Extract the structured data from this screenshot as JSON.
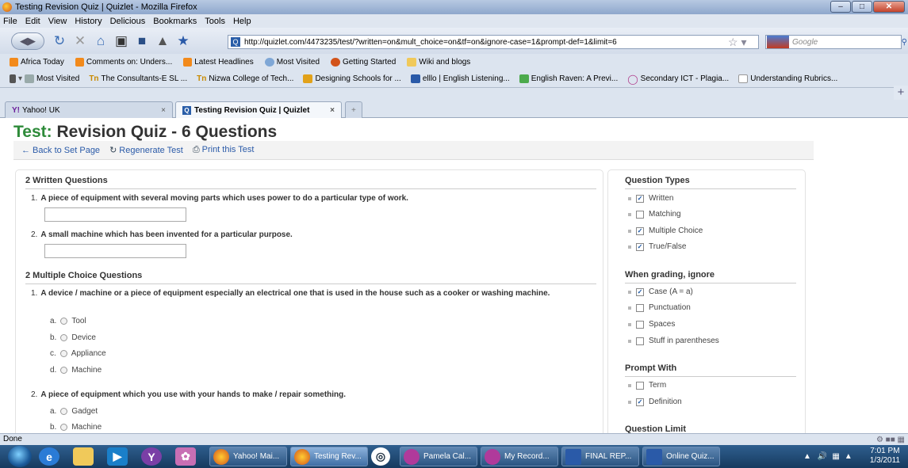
{
  "window": {
    "title": "Testing Revision Quiz | Quizlet - Mozilla Firefox"
  },
  "menu": [
    "File",
    "Edit",
    "View",
    "History",
    "Delicious",
    "Bookmarks",
    "Tools",
    "Help"
  ],
  "url": "http://quizlet.com/4473235/test/?written=on&mult_choice=on&tf=on&ignore-case=1&prompt-def=1&limit=6",
  "search_placeholder": "Google",
  "bookmarks_row1": [
    "Africa Today",
    "Comments on: Unders...",
    "Latest Headlines",
    "Most Visited",
    "Getting Started",
    "Wiki and blogs"
  ],
  "bookmarks_row2": [
    "Most Visited",
    "The Consultants-E SL ...",
    "Nizwa College of Tech...",
    "Designing Schools for ...",
    "elllo | English Listening...",
    "English Raven: A Previ...",
    "Secondary ICT - Plagia...",
    "Understanding Rubrics..."
  ],
  "tabs": [
    {
      "label": "Yahoo! UK"
    },
    {
      "label": "Testing Revision Quiz | Quizlet"
    }
  ],
  "page": {
    "title_label": "Test:",
    "title_text": "Revision Quiz - 6 Questions",
    "actions": [
      "← Back to Set Page",
      "Regenerate Test",
      "Print this Test"
    ]
  },
  "written": {
    "heading": "2 Written Questions",
    "questions": [
      {
        "num": "1.",
        "text": "A piece of equipment with several moving parts which uses power to do a particular type of work."
      },
      {
        "num": "2.",
        "text": "A small machine which has been invented for a particular purpose."
      }
    ]
  },
  "mc": {
    "heading": "2 Multiple Choice Questions",
    "questions": [
      {
        "num": "1.",
        "text": "A device / machine or a piece of equipment especially an electrical one that is used in the house such as a cooker or washing machine.",
        "options": [
          {
            "letter": "a.",
            "text": "Tool"
          },
          {
            "letter": "b.",
            "text": "Device"
          },
          {
            "letter": "c.",
            "text": "Appliance"
          },
          {
            "letter": "d.",
            "text": "Machine"
          }
        ]
      },
      {
        "num": "2.",
        "text": "A piece of equipment which you use with your hands to make / repair something.",
        "options": [
          {
            "letter": "a.",
            "text": "Gadget"
          },
          {
            "letter": "b.",
            "text": "Machine"
          }
        ]
      }
    ]
  },
  "sidebar": {
    "question_types": {
      "heading": "Question Types",
      "items": [
        {
          "label": "Written",
          "checked": true
        },
        {
          "label": "Matching",
          "checked": false
        },
        {
          "label": "Multiple Choice",
          "checked": true
        },
        {
          "label": "True/False",
          "checked": true
        }
      ]
    },
    "grading": {
      "heading": "When grading, ignore",
      "items": [
        {
          "label": "Case (A = a)",
          "checked": true
        },
        {
          "label": "Punctuation",
          "checked": false
        },
        {
          "label": "Spaces",
          "checked": false
        },
        {
          "label": "Stuff in parentheses",
          "checked": false
        }
      ]
    },
    "prompt": {
      "heading": "Prompt With",
      "items": [
        {
          "label": "Term",
          "checked": false
        },
        {
          "label": "Definition",
          "checked": true
        }
      ]
    },
    "limit_heading": "Question Limit"
  },
  "status": "Done",
  "taskbar": {
    "tasks": [
      "Yahoo! Mai...",
      "Testing Rev...",
      "Pamela Cal...",
      "My Record...",
      "FINAL REP...",
      "Online Quiz..."
    ],
    "time": "7:01 PM",
    "date": "1/3/2011"
  },
  "colors": {
    "accent_green": "#2e8b3a",
    "link_blue": "#2a5aa8",
    "check_blue": "#1a55a3"
  }
}
